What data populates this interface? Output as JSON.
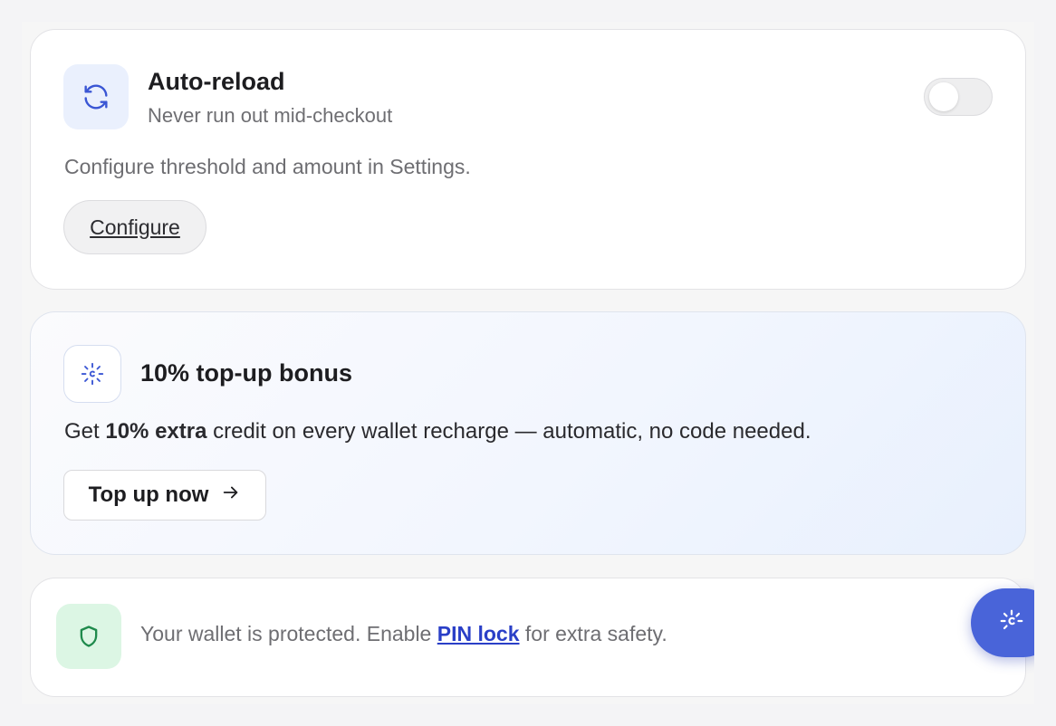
{
  "auto_reload": {
    "title": "Auto-reload",
    "subtitle": "Never run out mid-checkout",
    "toggle_on": false,
    "description": "Configure threshold and amount in Settings.",
    "configure_label": "Configure",
    "icon": "refresh-icon"
  },
  "bonus": {
    "title": "10% top-up bonus",
    "desc_prefix": "Get ",
    "desc_bold": "10% extra",
    "desc_suffix": " credit on every wallet recharge — automatic, no code needed.",
    "button_label": "Top up now",
    "button_arrow": "→",
    "icon": "sparkle-icon"
  },
  "security": {
    "text_prefix": "Your wallet is protected. Enable ",
    "link_label": "PIN lock",
    "text_suffix": " for extra safety.",
    "icon": "shield-icon"
  },
  "fab": {
    "icon": "sparkle-icon"
  },
  "colors": {
    "accent": "#4964d9",
    "link": "#2a3fc7",
    "success_bg": "#dcf6e4",
    "success_icon": "#1f8a4c"
  }
}
